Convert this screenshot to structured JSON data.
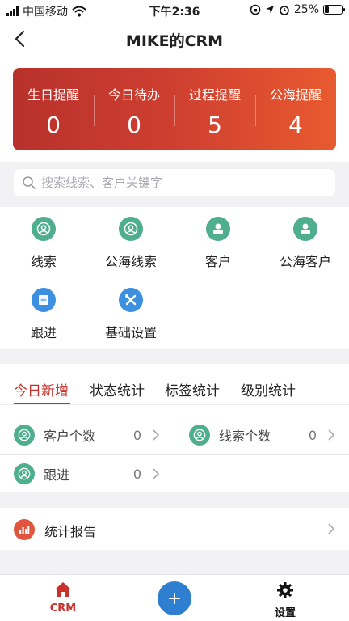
{
  "status_bar": {
    "carrier": "中国移动",
    "time": "下午2:36",
    "battery": "25%",
    "battery_level": 0.25
  },
  "header": {
    "title": "MIKE的CRM"
  },
  "reminders": [
    {
      "label": "生日提醒",
      "value": "0"
    },
    {
      "label": "今日待办",
      "value": "0"
    },
    {
      "label": "过程提醒",
      "value": "5"
    },
    {
      "label": "公海提醒",
      "value": "4"
    }
  ],
  "search": {
    "placeholder": "搜索线索、客户关键字"
  },
  "menu": [
    {
      "label": "线索",
      "icon": "user-circle-icon",
      "color": "#4fae8e"
    },
    {
      "label": "公海线索",
      "icon": "user-circle-icon",
      "color": "#4fae8e"
    },
    {
      "label": "客户",
      "icon": "customer-icon",
      "color": "#4fae8e"
    },
    {
      "label": "公海客户",
      "icon": "customer-icon",
      "color": "#4fae8e"
    },
    {
      "label": "跟进",
      "icon": "document-icon",
      "color": "#3d8fe0"
    },
    {
      "label": "基础设置",
      "icon": "tools-icon",
      "color": "#3d8fe0"
    }
  ],
  "tabs": [
    {
      "label": "今日新增",
      "active": true
    },
    {
      "label": "状态统计",
      "active": false
    },
    {
      "label": "标签统计",
      "active": false
    },
    {
      "label": "级别统计",
      "active": false
    }
  ],
  "stats": [
    {
      "label": "客户个数",
      "value": "0"
    },
    {
      "label": "线索个数",
      "value": "0"
    },
    {
      "label": "跟进",
      "value": "0"
    }
  ],
  "report": {
    "label": "统计报告"
  },
  "tabbar": {
    "crm": "CRM",
    "settings": "设置"
  },
  "colors": {
    "accent": "#c9322c",
    "green": "#4fae8e",
    "blue": "#2f7fd1"
  }
}
